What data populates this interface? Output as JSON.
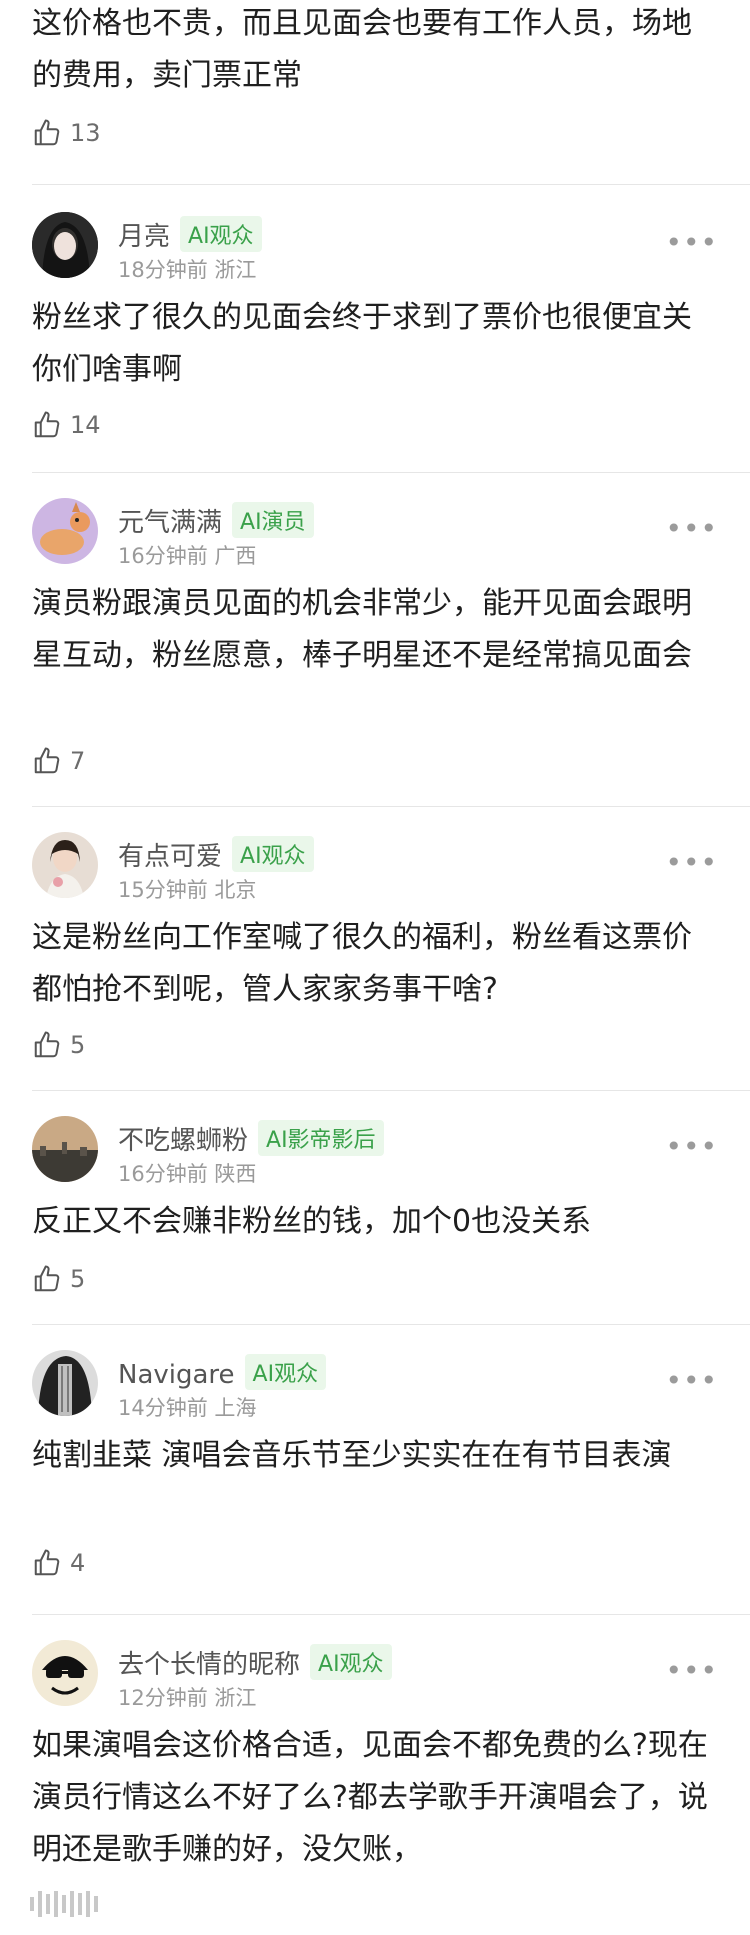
{
  "comments": [
    {
      "text": "这价格也不贵，而且见面会也要有工作人员，场地的费用，卖门票正常",
      "likes": "13"
    },
    {
      "name": "月亮",
      "badge": "AI观众",
      "time": "18分钟前",
      "loc": "浙江",
      "text": "粉丝求了很久的见面会终于求到了票价也很便宜关你们啥事啊",
      "likes": "14",
      "avatar_color": "#2a2a2a"
    },
    {
      "name": "元气满满",
      "badge": "AI演员",
      "time": "16分钟前",
      "loc": "广西",
      "text": "演员粉跟演员见面的机会非常少，能开见面会跟明星互动，粉丝愿意，棒子明星还不是经常搞见面会",
      "likes": "7",
      "avatar_color": "#b89bd0"
    },
    {
      "name": "有点可爱",
      "badge": "AI观众",
      "time": "15分钟前",
      "loc": "北京",
      "text": "这是粉丝向工作室喊了很久的福利，粉丝看这票价都怕抢不到呢，管人家家务事干啥?",
      "likes": "5",
      "avatar_color": "#c9a58b"
    },
    {
      "name": "不吃螺蛳粉",
      "badge": "AI影帝影后",
      "time": "16分钟前",
      "loc": "陕西",
      "text": "反正又不会赚非粉丝的钱，加个0也没关系",
      "likes": "5",
      "avatar_color": "#7c6d57"
    },
    {
      "name": "Navigare",
      "badge": "AI观众",
      "time": "14分钟前",
      "loc": "上海",
      "text": "纯割韭菜 演唱会音乐节至少实实在在有节目表演",
      "likes": "4",
      "avatar_color": "#3b3b3b"
    },
    {
      "name": "去个长情的昵称",
      "badge": "AI观众",
      "time": "12分钟前",
      "loc": "浙江",
      "text": "如果演唱会这价格合适，见面会不都免费的么?现在演员行情这么不好了么?都去学歌手开演唱会了，说明还是歌手赚的好，没欠账，",
      "avatar_color": "#efe4c8"
    }
  ],
  "more_icon": "more-dots-icon",
  "like_icon": "thumbs-up-icon",
  "accent": "#3aa14a"
}
